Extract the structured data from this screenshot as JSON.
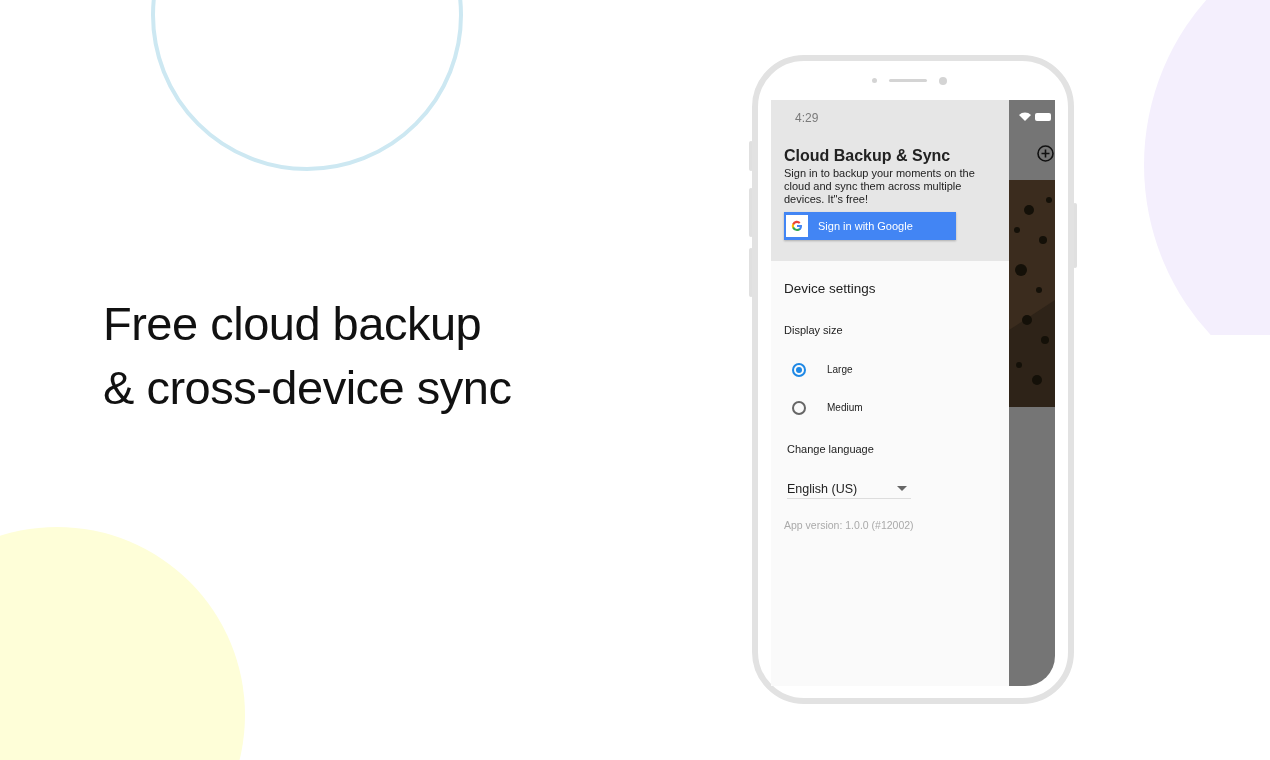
{
  "headline": {
    "lines": [
      "Free cloud backup",
      "& cross-device sync"
    ]
  },
  "status_bar": {
    "time": "4:29"
  },
  "drawer": {
    "title": "Cloud Backup & Sync",
    "description": "Sign in to backup your moments on the cloud and sync them across multiple devices. It\"s free!",
    "sign_in_button": "Sign in with Google",
    "section_title": "Device settings",
    "display_size": {
      "label": "Display size",
      "options": [
        {
          "label": "Large",
          "selected": true
        },
        {
          "label": "Medium",
          "selected": false
        }
      ]
    },
    "language": {
      "label": "Change language",
      "value": "English (US)"
    },
    "version": "App version: 1.0.0 (#12002)"
  }
}
